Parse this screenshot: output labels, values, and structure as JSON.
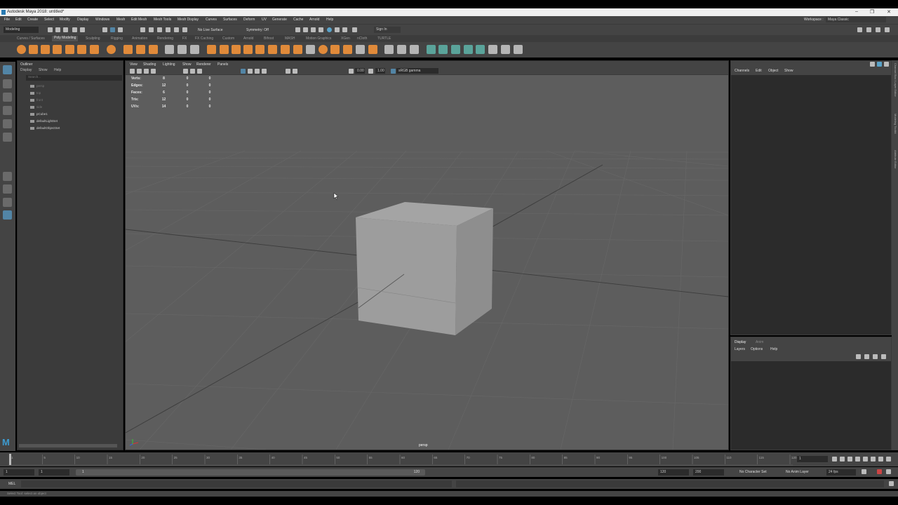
{
  "window": {
    "title": "Autodesk Maya 2018: untitled*",
    "minimize": "–",
    "restore": "❐",
    "close": "✕"
  },
  "menubar": [
    "File",
    "Edit",
    "Create",
    "Select",
    "Modify",
    "Display",
    "Windows",
    "Mesh",
    "Edit Mesh",
    "Mesh Tools",
    "Mesh Display",
    "Curves",
    "Surfaces",
    "Deform",
    "UV",
    "Generate",
    "Cache",
    "Arnold",
    "Help"
  ],
  "workspace": {
    "label": "Workspace :",
    "value": "Maya Classic"
  },
  "statusline": {
    "mode": "Modeling",
    "live_surface": "No Live Surface",
    "symmetry": "Symmetry: Off",
    "sign_in": "Sign In"
  },
  "shelf_tabs": [
    "Curves / Surfaces",
    "Poly Modeling",
    "Sculpting",
    "Rigging",
    "Animation",
    "Rendering",
    "FX",
    "FX Caching",
    "Custom",
    "Arnold",
    "Bifrost",
    "MASH",
    "Motion Graphics",
    "XGen",
    "nCloth",
    "TURTLE"
  ],
  "active_shelf_tab": "Poly Modeling",
  "outliner": {
    "title": "Outliner",
    "menus": [
      "Display",
      "Show",
      "Help"
    ],
    "search_placeholder": "Search...",
    "items": [
      {
        "label": "persp",
        "dim": true,
        "icon": "camera-icon"
      },
      {
        "label": "top",
        "dim": true,
        "icon": "camera-icon"
      },
      {
        "label": "front",
        "dim": true,
        "icon": "camera-icon"
      },
      {
        "label": "side",
        "dim": true,
        "icon": "camera-icon"
      },
      {
        "label": "pCube1",
        "dim": false,
        "icon": "mesh-icon"
      },
      {
        "label": "defaultLightSet",
        "dim": false,
        "icon": "set-icon"
      },
      {
        "label": "defaultObjectSet",
        "dim": false,
        "icon": "set-icon"
      }
    ]
  },
  "viewport": {
    "menus": [
      "View",
      "Shading",
      "Lighting",
      "Show",
      "Renderer",
      "Panels"
    ],
    "camera": "persp",
    "exposure": "0.00",
    "gamma": "1.00",
    "color_space": "sRGB gamma",
    "hud": [
      {
        "label": "Verts:",
        "values": [
          "8",
          "0",
          "0"
        ]
      },
      {
        "label": "Edges:",
        "values": [
          "12",
          "0",
          "0"
        ]
      },
      {
        "label": "Faces:",
        "values": [
          "6",
          "0",
          "0"
        ]
      },
      {
        "label": "Tris:",
        "values": [
          "12",
          "0",
          "0"
        ]
      },
      {
        "label": "UVs:",
        "values": [
          "14",
          "0",
          "0"
        ]
      }
    ]
  },
  "channel_box": {
    "menus": [
      "Channels",
      "Edit",
      "Object",
      "Show"
    ]
  },
  "layer_editor": {
    "tabs": [
      "Display",
      "Anim"
    ],
    "menus": [
      "Layers",
      "Options",
      "Help"
    ]
  },
  "side_tabs": [
    "Channel Box / Layer Editor",
    "Modeling Toolkit",
    "Attribute Editor"
  ],
  "timeline": {
    "ticks": [
      "1",
      "5",
      "10",
      "15",
      "20",
      "25",
      "30",
      "35",
      "40",
      "45",
      "50",
      "55",
      "60",
      "65",
      "70",
      "75",
      "80",
      "85",
      "90",
      "95",
      "100",
      "105",
      "110",
      "115",
      "120"
    ],
    "current_frame": "1"
  },
  "range": {
    "start": "1",
    "inner_start": "1",
    "slider_label": "1",
    "slider_end": "120",
    "inner_end": "120",
    "end": "200",
    "character_set": "No Character Set",
    "anim_layer": "No Anim Layer",
    "fps": "24 fps"
  },
  "command_line": {
    "label": "MEL"
  },
  "help_line": "Select Tool: select an object",
  "colors": {
    "accent": "#5285a6",
    "shelf_icon": "#e08a3a",
    "viewport_bg": "#5d5d5d"
  }
}
